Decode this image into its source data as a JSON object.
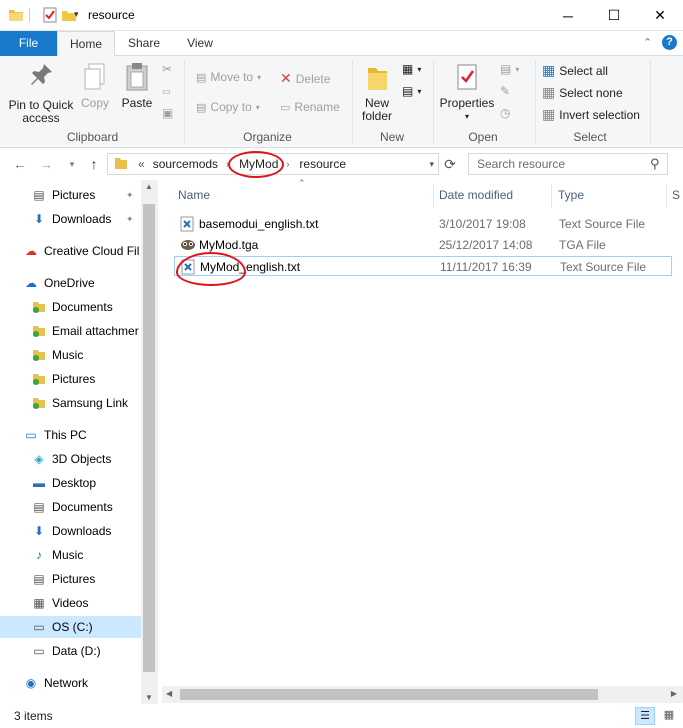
{
  "window": {
    "title": "resource",
    "controls": {
      "minimize": "─",
      "maximize": "☐",
      "close": "✕"
    }
  },
  "tabs": {
    "file": "File",
    "home": "Home",
    "share": "Share",
    "view": "View"
  },
  "ribbon": {
    "clipboard": {
      "label": "Clipboard",
      "pin": "Pin to Quick access",
      "pin_line1": "Pin to Quick",
      "pin_line2": "access",
      "copy": "Copy",
      "paste": "Paste"
    },
    "organize": {
      "label": "Organize",
      "move_to": "Move to",
      "copy_to": "Copy to",
      "delete": "Delete",
      "rename": "Rename"
    },
    "new": {
      "label": "New",
      "new_folder_line1": "New",
      "new_folder_line2": "folder"
    },
    "open": {
      "label": "Open",
      "properties": "Properties"
    },
    "select": {
      "label": "Select",
      "select_all": "Select all",
      "select_none": "Select none",
      "invert": "Invert selection"
    }
  },
  "address": {
    "overflow": "«",
    "crumbs": [
      "sourcemods",
      "MyMod",
      "resource"
    ]
  },
  "search": {
    "placeholder": "Search resource"
  },
  "nav": {
    "items": [
      {
        "label": "Pictures",
        "icon": "pictures-icon",
        "pinned": true
      },
      {
        "label": "Downloads",
        "icon": "downloads-icon",
        "pinned": true
      },
      {
        "label": "Creative Cloud Fil",
        "icon": "creative-cloud-icon"
      },
      {
        "label": "OneDrive",
        "icon": "onedrive-icon"
      },
      {
        "label": "Documents",
        "icon": "synced-folder-icon"
      },
      {
        "label": "Email attachmer",
        "icon": "synced-folder-icon"
      },
      {
        "label": "Music",
        "icon": "synced-folder-icon"
      },
      {
        "label": "Pictures",
        "icon": "synced-folder-icon"
      },
      {
        "label": "Samsung Link",
        "icon": "synced-folder-icon"
      },
      {
        "label": "This PC",
        "icon": "computer-icon"
      },
      {
        "label": "3D Objects",
        "icon": "3d-objects-icon"
      },
      {
        "label": "Desktop",
        "icon": "desktop-icon"
      },
      {
        "label": "Documents",
        "icon": "documents-icon"
      },
      {
        "label": "Downloads",
        "icon": "downloads-icon"
      },
      {
        "label": "Music",
        "icon": "music-icon"
      },
      {
        "label": "Pictures",
        "icon": "pictures-icon"
      },
      {
        "label": "Videos",
        "icon": "videos-icon"
      },
      {
        "label": "OS (C:)",
        "icon": "drive-c-icon",
        "selected": true
      },
      {
        "label": "Data (D:)",
        "icon": "drive-d-icon"
      },
      {
        "label": "Network",
        "icon": "network-icon"
      }
    ]
  },
  "columns": {
    "name": "Name",
    "modified": "Date modified",
    "type": "Type",
    "size": "S"
  },
  "files": [
    {
      "name": "basemodui_english.txt",
      "modified": "3/10/2017 19:08",
      "type": "Text Source File",
      "icon": "vscode-file-icon"
    },
    {
      "name": "MyMod.tga",
      "modified": "25/12/2017 14:08",
      "type": "TGA File",
      "icon": "gimp-file-icon"
    },
    {
      "name": "MyMod_english.txt",
      "modified": "11/11/2017 16:39",
      "type": "Text Source File",
      "icon": "vscode-file-icon",
      "selected": true
    }
  ],
  "status": {
    "count": "3 items"
  },
  "colors": {
    "accent": "#1979ca",
    "selection": "#cce8ff",
    "annotation": "#e0141c"
  }
}
